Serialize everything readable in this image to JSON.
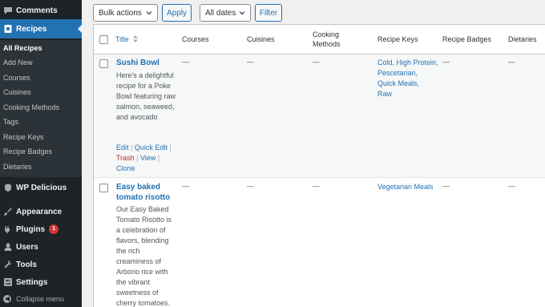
{
  "sidebar": {
    "comments_label": "Comments",
    "recipes_label": "Recipes",
    "recipes_submenu": [
      "All Recipes",
      "Add New",
      "Courses",
      "Cuisines",
      "Cooking Methods",
      "Tags",
      "Recipe Keys",
      "Recipe Badges",
      "Dietaries"
    ],
    "wp_delicious_label": "WP Delicious",
    "appearance_label": "Appearance",
    "plugins_label": "Plugins",
    "plugins_badge": "1",
    "users_label": "Users",
    "tools_label": "Tools",
    "settings_label": "Settings",
    "collapse_label": "Collapse menu"
  },
  "filters": {
    "bulk_actions": "Bulk actions",
    "apply": "Apply",
    "all_dates": "All dates",
    "filter": "Filter"
  },
  "table": {
    "headers": {
      "title": "Title",
      "courses": "Courses",
      "cuisines": "Cuisines",
      "cooking_methods_line1": "Cooking",
      "cooking_methods_line2": "Methods",
      "recipe_keys": "Recipe Keys",
      "recipe_badges": "Recipe Badges",
      "dietaries": "Dietaries"
    },
    "dash": "—",
    "rows": [
      {
        "title": "Sushi Bowl",
        "excerpt": "Here's a delightful recipe for a Poke Bowl featuring raw salmon, seaweed, and avocado",
        "recipe_keys": [
          "Cold",
          "High Protein",
          "Pescetarian",
          "Quick Meals",
          "Raw"
        ],
        "actions": {
          "edit": "Edit",
          "quick_edit": "Quick Edit",
          "trash": "Trash",
          "view": "View",
          "clone": "Clone",
          "sep": "|"
        }
      },
      {
        "title": "Easy baked tomato risotto",
        "excerpt": "Our Easy Baked Tomato Risotto is a celebration of flavors, blending the rich creaminess of Arborio rice with the vibrant sweetness of cherry tomatoes.",
        "recipe_keys": [
          "Vegetarian Meals"
        ]
      }
    ]
  }
}
